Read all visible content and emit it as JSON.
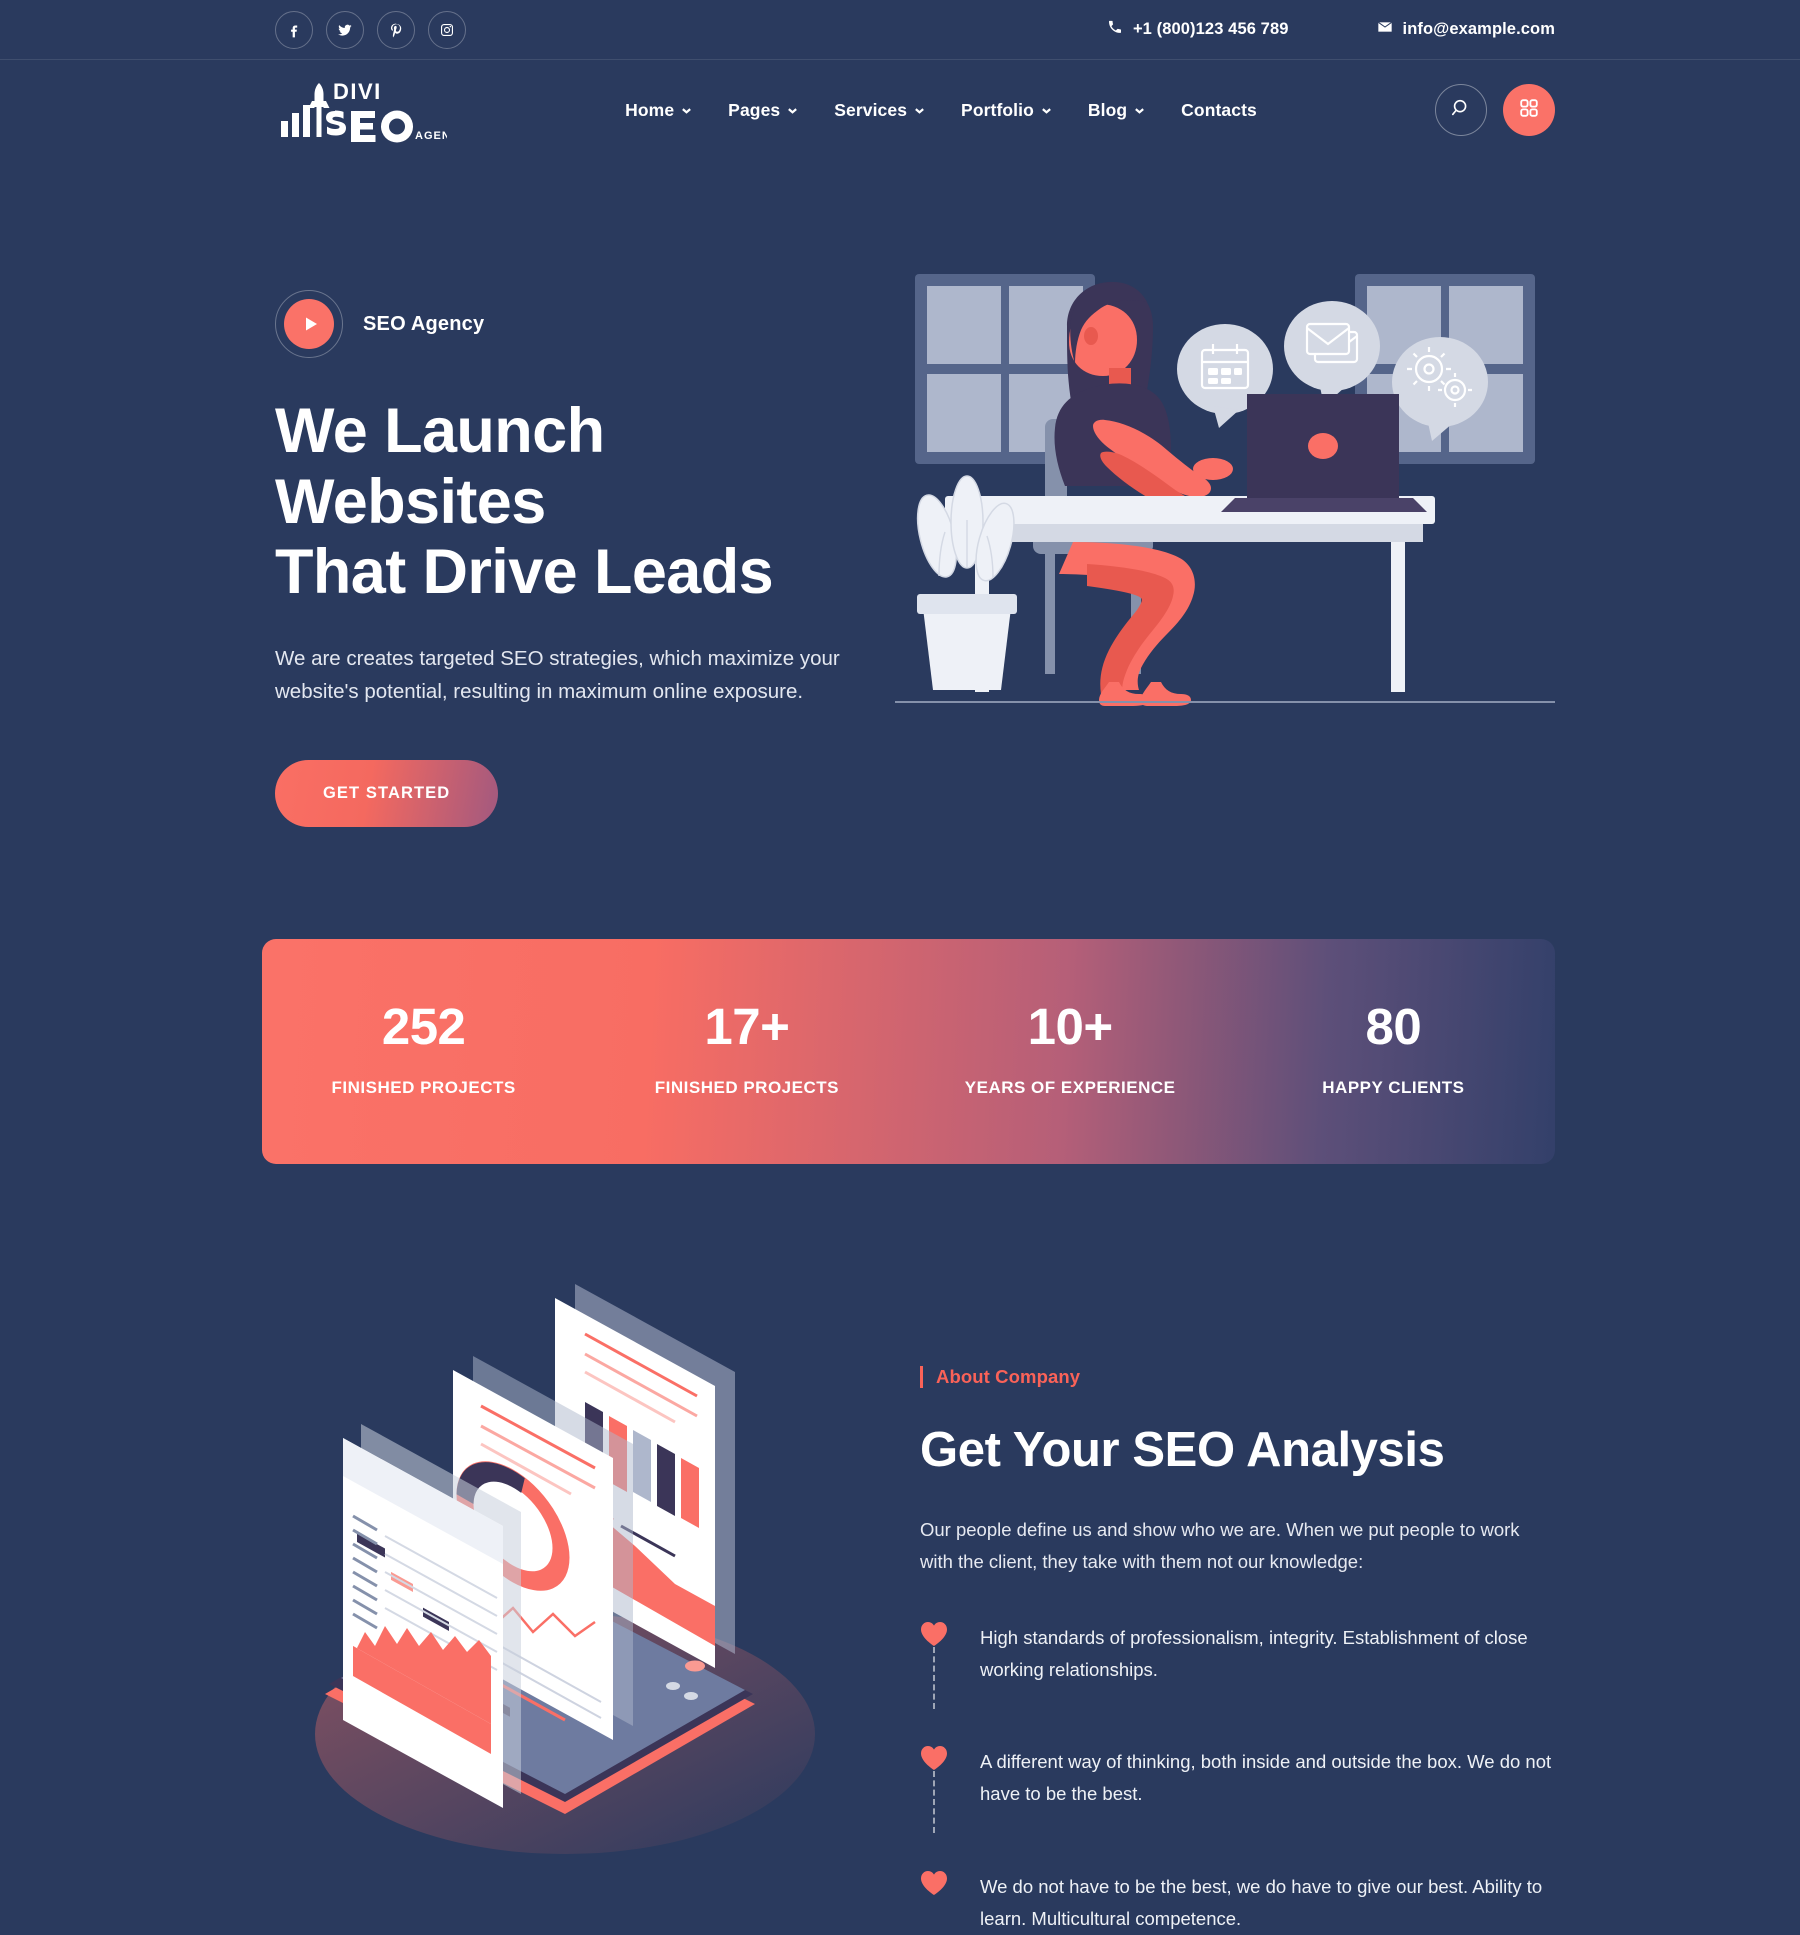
{
  "colors": {
    "background": "#2a3a5e",
    "accent": "#fa7268",
    "accent_dark": "#fa6258",
    "text": "#ffffff"
  },
  "topbar": {
    "social": [
      {
        "name": "facebook-icon",
        "label": "Facebook"
      },
      {
        "name": "twitter-icon",
        "label": "Twitter"
      },
      {
        "name": "pinterest-icon",
        "label": "Pinterest"
      },
      {
        "name": "instagram-icon",
        "label": "Instagram"
      }
    ],
    "phone": "+1 (800)123 456 789",
    "email": "info@example.com"
  },
  "header": {
    "logo": {
      "line1": "DIVI",
      "line2": "SEO",
      "suffix": "AGENCY"
    },
    "nav": [
      {
        "label": "Home",
        "has_dropdown": true
      },
      {
        "label": "Pages",
        "has_dropdown": true
      },
      {
        "label": "Services",
        "has_dropdown": true
      },
      {
        "label": "Portfolio",
        "has_dropdown": true
      },
      {
        "label": "Blog",
        "has_dropdown": true
      },
      {
        "label": "Contacts",
        "has_dropdown": false
      }
    ],
    "search_icon": "search-icon",
    "grid_icon": "grid-menu-icon"
  },
  "hero": {
    "eyebrow": "SEO Agency",
    "title_line1": "We Launch Websites",
    "title_line2": "That Drive Leads",
    "subtitle": "We are creates targeted SEO strategies, which maximize your website's potential, resulting in maximum online exposure.",
    "cta": "GET STARTED",
    "illustration": "woman-at-desk-with-laptop-illustration"
  },
  "stats": [
    {
      "value": "252",
      "label": "FINISHED PROJECTS"
    },
    {
      "value": "17+",
      "label": "FINISHED PROJECTS"
    },
    {
      "value": "10+",
      "label": "YEARS OF EXPERIENCE"
    },
    {
      "value": "80",
      "label": "HAPPY CLIENTS"
    }
  ],
  "about": {
    "kicker": "About Company",
    "title": "Get Your SEO Analysis",
    "paragraph": "Our people define us and show who we are. When we put people to work with the client, they take with them not our knowledge:",
    "illustration": "isometric-phone-analytics-dashboard-illustration",
    "features": [
      {
        "text": "High standards of professionalism, integrity. Establishment of close working relationships."
      },
      {
        "text": "A different way of thinking, both inside and outside the box. We do not have to be the best."
      },
      {
        "text": "We do not have to be the best, we do have to give our best. Ability to learn. Multicultural competence."
      }
    ]
  }
}
